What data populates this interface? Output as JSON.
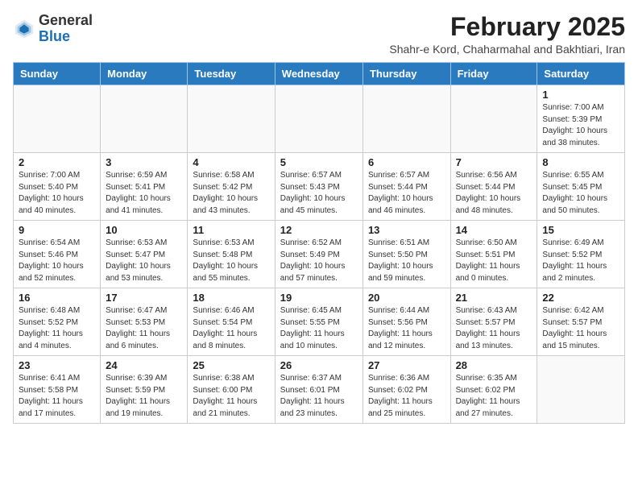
{
  "header": {
    "logo_general": "General",
    "logo_blue": "Blue",
    "month_title": "February 2025",
    "location": "Shahr-e Kord, Chaharmahal and Bakhtiari, Iran"
  },
  "weekdays": [
    "Sunday",
    "Monday",
    "Tuesday",
    "Wednesday",
    "Thursday",
    "Friday",
    "Saturday"
  ],
  "weeks": [
    [
      {
        "day": "",
        "info": ""
      },
      {
        "day": "",
        "info": ""
      },
      {
        "day": "",
        "info": ""
      },
      {
        "day": "",
        "info": ""
      },
      {
        "day": "",
        "info": ""
      },
      {
        "day": "",
        "info": ""
      },
      {
        "day": "1",
        "info": "Sunrise: 7:00 AM\nSunset: 5:39 PM\nDaylight: 10 hours\nand 38 minutes."
      }
    ],
    [
      {
        "day": "2",
        "info": "Sunrise: 7:00 AM\nSunset: 5:40 PM\nDaylight: 10 hours\nand 40 minutes."
      },
      {
        "day": "3",
        "info": "Sunrise: 6:59 AM\nSunset: 5:41 PM\nDaylight: 10 hours\nand 41 minutes."
      },
      {
        "day": "4",
        "info": "Sunrise: 6:58 AM\nSunset: 5:42 PM\nDaylight: 10 hours\nand 43 minutes."
      },
      {
        "day": "5",
        "info": "Sunrise: 6:57 AM\nSunset: 5:43 PM\nDaylight: 10 hours\nand 45 minutes."
      },
      {
        "day": "6",
        "info": "Sunrise: 6:57 AM\nSunset: 5:44 PM\nDaylight: 10 hours\nand 46 minutes."
      },
      {
        "day": "7",
        "info": "Sunrise: 6:56 AM\nSunset: 5:44 PM\nDaylight: 10 hours\nand 48 minutes."
      },
      {
        "day": "8",
        "info": "Sunrise: 6:55 AM\nSunset: 5:45 PM\nDaylight: 10 hours\nand 50 minutes."
      }
    ],
    [
      {
        "day": "9",
        "info": "Sunrise: 6:54 AM\nSunset: 5:46 PM\nDaylight: 10 hours\nand 52 minutes."
      },
      {
        "day": "10",
        "info": "Sunrise: 6:53 AM\nSunset: 5:47 PM\nDaylight: 10 hours\nand 53 minutes."
      },
      {
        "day": "11",
        "info": "Sunrise: 6:53 AM\nSunset: 5:48 PM\nDaylight: 10 hours\nand 55 minutes."
      },
      {
        "day": "12",
        "info": "Sunrise: 6:52 AM\nSunset: 5:49 PM\nDaylight: 10 hours\nand 57 minutes."
      },
      {
        "day": "13",
        "info": "Sunrise: 6:51 AM\nSunset: 5:50 PM\nDaylight: 10 hours\nand 59 minutes."
      },
      {
        "day": "14",
        "info": "Sunrise: 6:50 AM\nSunset: 5:51 PM\nDaylight: 11 hours\nand 0 minutes."
      },
      {
        "day": "15",
        "info": "Sunrise: 6:49 AM\nSunset: 5:52 PM\nDaylight: 11 hours\nand 2 minutes."
      }
    ],
    [
      {
        "day": "16",
        "info": "Sunrise: 6:48 AM\nSunset: 5:52 PM\nDaylight: 11 hours\nand 4 minutes."
      },
      {
        "day": "17",
        "info": "Sunrise: 6:47 AM\nSunset: 5:53 PM\nDaylight: 11 hours\nand 6 minutes."
      },
      {
        "day": "18",
        "info": "Sunrise: 6:46 AM\nSunset: 5:54 PM\nDaylight: 11 hours\nand 8 minutes."
      },
      {
        "day": "19",
        "info": "Sunrise: 6:45 AM\nSunset: 5:55 PM\nDaylight: 11 hours\nand 10 minutes."
      },
      {
        "day": "20",
        "info": "Sunrise: 6:44 AM\nSunset: 5:56 PM\nDaylight: 11 hours\nand 12 minutes."
      },
      {
        "day": "21",
        "info": "Sunrise: 6:43 AM\nSunset: 5:57 PM\nDaylight: 11 hours\nand 13 minutes."
      },
      {
        "day": "22",
        "info": "Sunrise: 6:42 AM\nSunset: 5:57 PM\nDaylight: 11 hours\nand 15 minutes."
      }
    ],
    [
      {
        "day": "23",
        "info": "Sunrise: 6:41 AM\nSunset: 5:58 PM\nDaylight: 11 hours\nand 17 minutes."
      },
      {
        "day": "24",
        "info": "Sunrise: 6:39 AM\nSunset: 5:59 PM\nDaylight: 11 hours\nand 19 minutes."
      },
      {
        "day": "25",
        "info": "Sunrise: 6:38 AM\nSunset: 6:00 PM\nDaylight: 11 hours\nand 21 minutes."
      },
      {
        "day": "26",
        "info": "Sunrise: 6:37 AM\nSunset: 6:01 PM\nDaylight: 11 hours\nand 23 minutes."
      },
      {
        "day": "27",
        "info": "Sunrise: 6:36 AM\nSunset: 6:02 PM\nDaylight: 11 hours\nand 25 minutes."
      },
      {
        "day": "28",
        "info": "Sunrise: 6:35 AM\nSunset: 6:02 PM\nDaylight: 11 hours\nand 27 minutes."
      },
      {
        "day": "",
        "info": ""
      }
    ]
  ]
}
